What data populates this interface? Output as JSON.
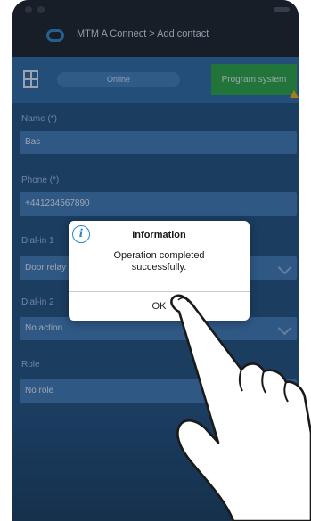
{
  "header": {
    "title": "MTM A Connect > Add contact"
  },
  "toolbar": {
    "segment_label": "Online",
    "program_button": "Program system"
  },
  "form": {
    "name_label": "Name (*)",
    "name_value": "Bas",
    "phone_label": "Phone (*)",
    "phone_value": "+441234567890",
    "dial_label": "Dial-in 1",
    "dial_value": "Door relay",
    "dial2_label": "Dial-in 2",
    "dial2_value": "No action",
    "role_label": "Role",
    "role_value": "No role"
  },
  "dialog": {
    "icon": "info-icon",
    "title": "Information",
    "message": "Operation completed successfully.",
    "ok_label": "OK"
  },
  "colors": {
    "header_bg": "#1b1f26",
    "toolbar_bg": "#2b69a4",
    "program_button": "#28a341",
    "field_bg": "#3e78b4",
    "info_accent": "#2e86c8"
  }
}
